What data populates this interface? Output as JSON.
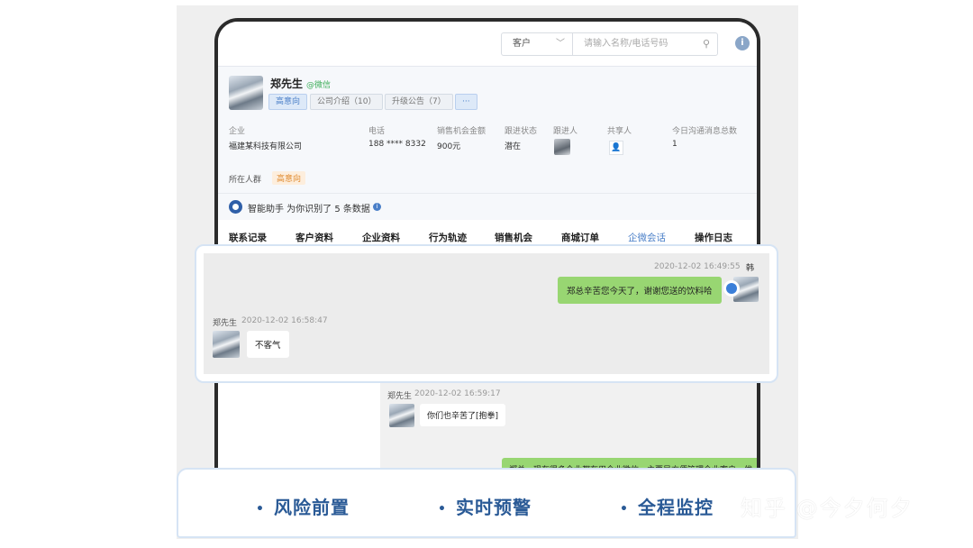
{
  "search": {
    "type_select": "客户",
    "placeholder": "请输入名称/电话号码"
  },
  "customer": {
    "name": "郑先生",
    "source": "@微信",
    "tags": [
      "高意向",
      "公司介绍（10）",
      "升级公告（7）",
      "···"
    ],
    "fields": [
      {
        "label": "企业",
        "value": "福建某科技有限公司"
      },
      {
        "label": "电话",
        "value": "188 **** 8332"
      },
      {
        "label": "销售机会金额",
        "value": "900元"
      },
      {
        "label": "跟进状态",
        "value": "潜在"
      },
      {
        "label": "跟进人",
        "value": ""
      },
      {
        "label": "共享人",
        "value": ""
      },
      {
        "label": "今日沟通消息总数",
        "value": "1"
      }
    ],
    "crowd_label": "所在人群",
    "crowd_tag": "高意向"
  },
  "assistant": {
    "text": "智能助手 为你识别了 5 条数据"
  },
  "tabs": [
    "联系记录",
    "客户资料",
    "企业资料",
    "行为轨迹",
    "销售机会",
    "商城订单",
    "企微会话",
    "操作日志"
  ],
  "active_tab": "企微会话",
  "chat": {
    "msg1": {
      "time": "2020-12-02 16:49:55",
      "sender": "韩",
      "text": "郑总辛苦您今天了，谢谢您送的饮料哈"
    },
    "msg2": {
      "sender": "郑先生",
      "time": "2020-12-02 16:58:47",
      "text": "不客气"
    },
    "msg3": {
      "sender": "郑先生",
      "time": "2020-12-02 16:59:17",
      "text": "你们也辛苦了[抱拳]"
    },
    "msg4_partial": "郑总，现在很多企业都在用企业微信，主要是方便管理企业客户，优"
  },
  "footer": {
    "features": [
      "风险前置",
      "实时预警",
      "全程监控"
    ]
  },
  "watermark": "知乎 @今夕何夕"
}
